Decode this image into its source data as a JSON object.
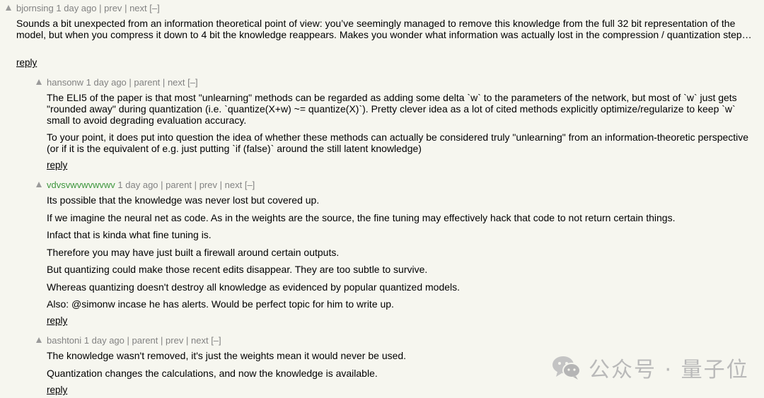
{
  "comments": [
    {
      "user": "bjornsing",
      "age": "1 day ago",
      "links": [
        "prev",
        "next"
      ],
      "toggle": "[–]",
      "paragraphs": [
        "Sounds a bit unexpected from an information theoretical point of view: you’ve seemingly managed to remove this knowledge from the full 32 bit representation of the model, but when you compress it down to 4 bit the knowledge reappears. Makes you wonder what information was actually lost in the compression / quantization step…"
      ],
      "reply": "reply"
    },
    {
      "user": "hansonw",
      "age": "1 day ago",
      "links": [
        "parent",
        "next"
      ],
      "toggle": "[–]",
      "paragraphs": [
        "The ELI5 of the paper is that most \"unlearning\" methods can be regarded as adding some delta `w` to the parameters of the network, but most of `w` just gets \"rounded away\" during quantization (i.e. `quantize(X+w) ~= quantize(X)`). Pretty clever idea as a lot of cited methods explicitly optimize/regularize to keep `w` small to avoid degrading evaluation accuracy.",
        "To your point, it does put into question the idea of whether these methods can actually be considered truly \"unlearning\" from an information-theoretic perspective (or if it is the equivalent of e.g. just putting `if (false)` around the still latent knowledge)"
      ],
      "reply": "reply"
    },
    {
      "user": "vdvsvwvwvwvwv",
      "age": "1 day ago",
      "links": [
        "parent",
        "prev",
        "next"
      ],
      "toggle": "[–]",
      "paragraphs": [
        "Its possible that the knowledge was never lost but covered up.",
        "If we imagine the neural net as code. As in the weights are the source, the fine tuning may effectively hack that code to not return certain things.",
        "Infact that is kinda what fine tuning is.",
        "Therefore you may have just built a firewall around certain outputs.",
        "But quantizing could make those recent edits disappear. They are too subtle to survive.",
        "Whereas quantizing doesn't destroy all knowledge as evidenced by popular quantized models.",
        "Also: @simonw incase he has alerts. Would be perfect topic for him to write up."
      ],
      "reply": "reply"
    },
    {
      "user": "bashtoni",
      "age": "1 day ago",
      "links": [
        "parent",
        "prev",
        "next"
      ],
      "toggle": "[–]",
      "paragraphs": [
        "The knowledge wasn't removed, it's just the weights mean it would never be used.",
        "Quantization changes the calculations, and now the knowledge is available."
      ],
      "reply": "reply"
    }
  ],
  "watermark": {
    "text": "公众号 · 量子位",
    "icon": "wechat-icon"
  }
}
